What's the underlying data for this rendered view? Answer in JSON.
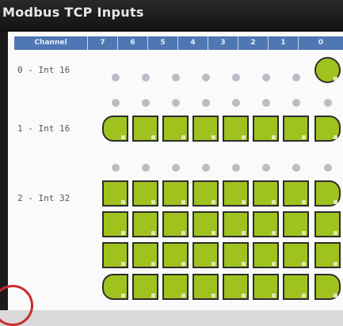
{
  "window": {
    "title": "Modbus TCP Inputs"
  },
  "table": {
    "columns": [
      "Channel",
      "7",
      "6",
      "5",
      "4",
      "3",
      "2",
      "1",
      "0"
    ],
    "rows": [
      {
        "label": "0 - Int 16",
        "states": [
          0,
          0,
          0,
          0,
          0,
          0,
          0,
          1
        ]
      },
      {
        "label": "1 - Int 16",
        "states": [
          1,
          1,
          1,
          1,
          1,
          1,
          1,
          1
        ]
      },
      {
        "label": "2 - Int 32",
        "states": [
          1,
          1,
          1,
          1,
          1,
          1,
          1,
          1
        ]
      }
    ]
  },
  "colors": {
    "header": "#4f77b3",
    "active": "#a0c21e",
    "inactive": "#b8bec5",
    "accent_ring": "#cc2a2a"
  },
  "icons": {
    "inactive_bit": "gray-dot-icon",
    "active_bit": "green-led-tile-icon"
  }
}
